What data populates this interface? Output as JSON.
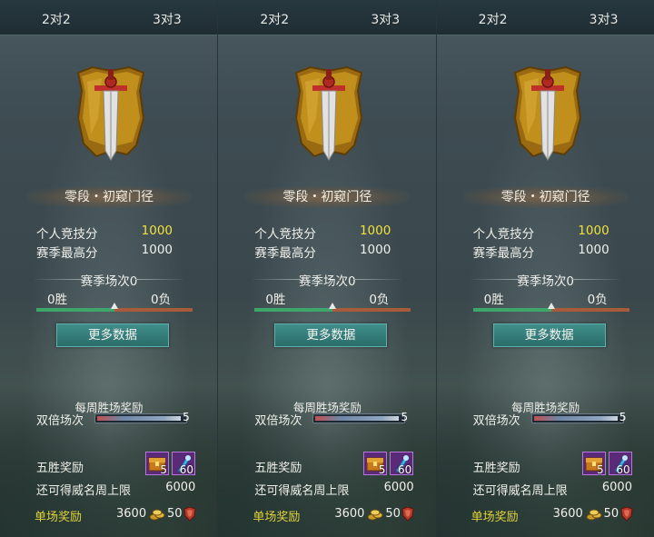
{
  "colors": {
    "accent_yellow": "#f0e23a",
    "win_green": "#3ea66a",
    "loss_orange": "#a85a3a",
    "button": "#2b6d6b"
  },
  "panels": [
    {
      "tabs": [
        "2对2",
        "3对3"
      ],
      "rank_title": "零段・初窥门径",
      "stats": [
        {
          "label": "个人竞技分",
          "value": "1000"
        },
        {
          "label": "赛季最高分",
          "value": "1000"
        }
      ],
      "season": {
        "label": "赛季场次0",
        "wins": "0胜",
        "losses": "0负",
        "win_ratio": 0.5
      },
      "more_button": "更多数据",
      "weekly": {
        "title": "每周胜场奖励",
        "double_label": "双倍场次",
        "double_count": "5"
      },
      "five_win": {
        "label": "五胜奖励",
        "items": [
          {
            "icon": "chest-item-icon",
            "count": "5"
          },
          {
            "icon": "blue-gem-item-icon",
            "count": "60"
          }
        ]
      },
      "fame_cap": {
        "label": "还可得威名周上限",
        "value": "6000"
      },
      "single": {
        "label": "单场奖励",
        "coins": "3600",
        "fame": "50"
      }
    },
    {
      "tabs": [
        "2对2",
        "3对3"
      ],
      "rank_title": "零段・初窥门径",
      "stats": [
        {
          "label": "个人竞技分",
          "value": "1000"
        },
        {
          "label": "赛季最高分",
          "value": "1000"
        }
      ],
      "season": {
        "label": "赛季场次0",
        "wins": "0胜",
        "losses": "0负",
        "win_ratio": 0.5
      },
      "more_button": "更多数据",
      "weekly": {
        "title": "每周胜场奖励",
        "double_label": "双倍场次",
        "double_count": "5"
      },
      "five_win": {
        "label": "五胜奖励",
        "items": [
          {
            "icon": "chest-item-icon",
            "count": "5"
          },
          {
            "icon": "blue-gem-item-icon",
            "count": "60"
          }
        ]
      },
      "fame_cap": {
        "label": "还可得威名周上限",
        "value": "6000"
      },
      "single": {
        "label": "单场奖励",
        "coins": "3600",
        "fame": "50"
      }
    },
    {
      "tabs": [
        "2对2",
        "3对3"
      ],
      "rank_title": "零段・初窥门径",
      "stats": [
        {
          "label": "个人竞技分",
          "value": "1000"
        },
        {
          "label": "赛季最高分",
          "value": "1000"
        }
      ],
      "season": {
        "label": "赛季场次0",
        "wins": "0胜",
        "losses": "0负",
        "win_ratio": 0.5
      },
      "more_button": "更多数据",
      "weekly": {
        "title": "每周胜场奖励",
        "double_label": "双倍场次",
        "double_count": "5"
      },
      "five_win": {
        "label": "五胜奖励",
        "items": [
          {
            "icon": "chest-item-icon",
            "count": "5"
          },
          {
            "icon": "blue-gem-item-icon",
            "count": "60"
          }
        ]
      },
      "fame_cap": {
        "label": "还可得威名周上限",
        "value": "6000"
      },
      "single": {
        "label": "单场奖励",
        "coins": "3600",
        "fame": "50"
      }
    }
  ]
}
